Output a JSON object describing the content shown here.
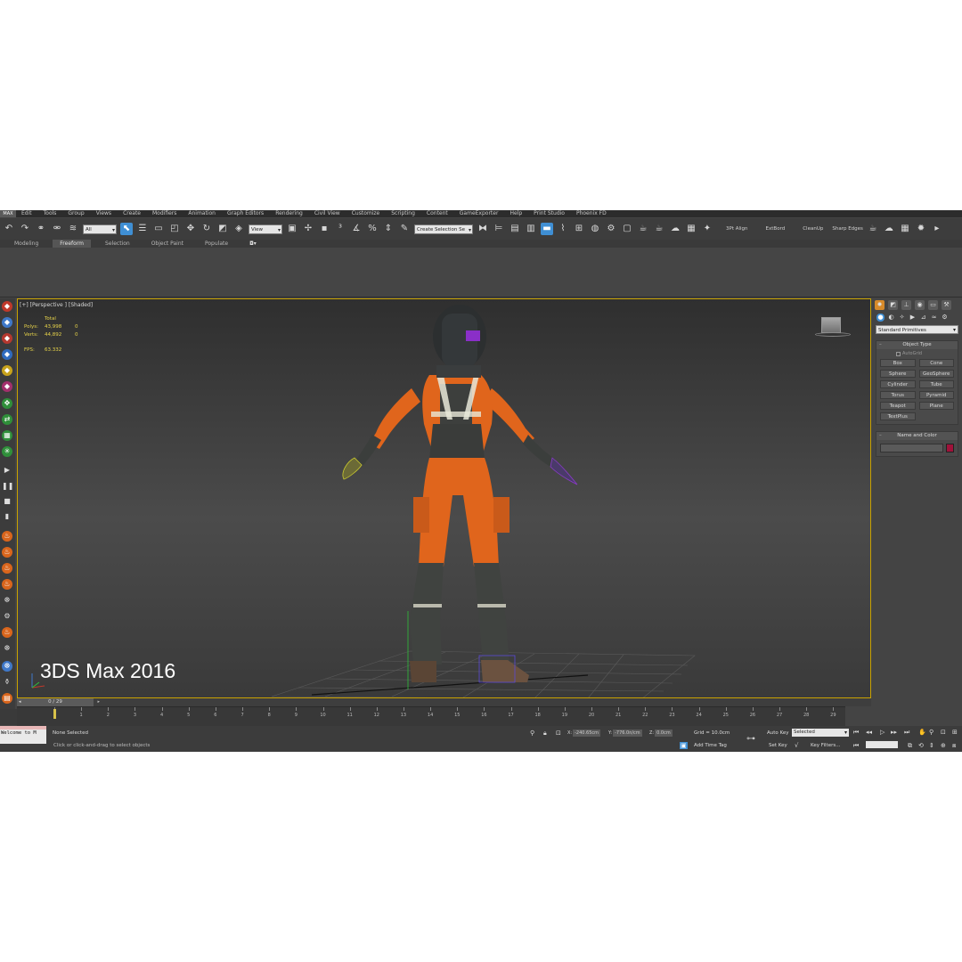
{
  "menu": {
    "logo": "MAX",
    "items": [
      "Edit",
      "Tools",
      "Group",
      "Views",
      "Create",
      "Modifiers",
      "Animation",
      "Graph Editors",
      "Rendering",
      "Civil View",
      "Customize",
      "Scripting",
      "Content",
      "GameExporter",
      "Help",
      "Print Studio",
      "Phoenix FD"
    ]
  },
  "toolbar": {
    "filter_value": "All",
    "refcoord_value": "View",
    "selection_set_value": "Create Selection Se",
    "plugin_labels": [
      "3Pt Align",
      "ExtBord",
      "CleanUp",
      "Sharp Edges"
    ]
  },
  "ribbon": {
    "tabs": [
      "Modeling",
      "Freeform",
      "Selection",
      "Object Paint",
      "Populate"
    ],
    "active_tab": "Freeform"
  },
  "viewport": {
    "label": "[+] [Perspective ] [Shaded]",
    "stats": {
      "header": "Total",
      "polys_label": "Polys:",
      "polys_total": "43,998",
      "polys_sel": "0",
      "verts_label": "Verts:",
      "verts_total": "44,892",
      "verts_sel": "0",
      "fps_label": "FPS:",
      "fps_value": "63.332"
    },
    "watermark": "3DS Max 2016"
  },
  "command_panel": {
    "dropdown": "Standard Primitives",
    "object_type": {
      "title": "Object Type",
      "autogrid": "AutoGrid",
      "buttons": [
        "Box",
        "Cone",
        "Sphere",
        "GeoSphere",
        "Cylinder",
        "Tube",
        "Torus",
        "Pyramid",
        "Teapot",
        "Plane",
        "TextPlus"
      ]
    },
    "name_color": {
      "title": "Name and Color",
      "swatch_color": "#a0123a"
    }
  },
  "timeline": {
    "position": "0 / 29",
    "ticks": [
      "0",
      "1",
      "2",
      "3",
      "4",
      "5",
      "6",
      "7",
      "8",
      "9",
      "10",
      "11",
      "12",
      "13",
      "14",
      "15",
      "16",
      "17",
      "18",
      "19",
      "20",
      "21",
      "22",
      "23",
      "24",
      "25",
      "26",
      "27",
      "28",
      "29"
    ]
  },
  "status": {
    "maxscript": "Welcome to M",
    "selection": "None Selected",
    "prompt": "Click or click-and-drag to select objects",
    "x_label": "X:",
    "x_value": "-240.65cm",
    "y_label": "Y:",
    "y_value": "-776.0n/cm",
    "z_label": "Z:",
    "z_value": "0.0cm",
    "grid": "Grid = 10.0cm",
    "add_time_tag": "Add Time Tag",
    "auto_key": "Auto Key",
    "set_key": "Set Key",
    "key_mode": "Selected",
    "key_filters": "Key Filters..."
  },
  "colors": {
    "accent_blue": "#3f8fd4",
    "viewport_border": "#c9a200",
    "stats_yellow": "#e8d44a",
    "suit_orange": "#e0651c"
  }
}
